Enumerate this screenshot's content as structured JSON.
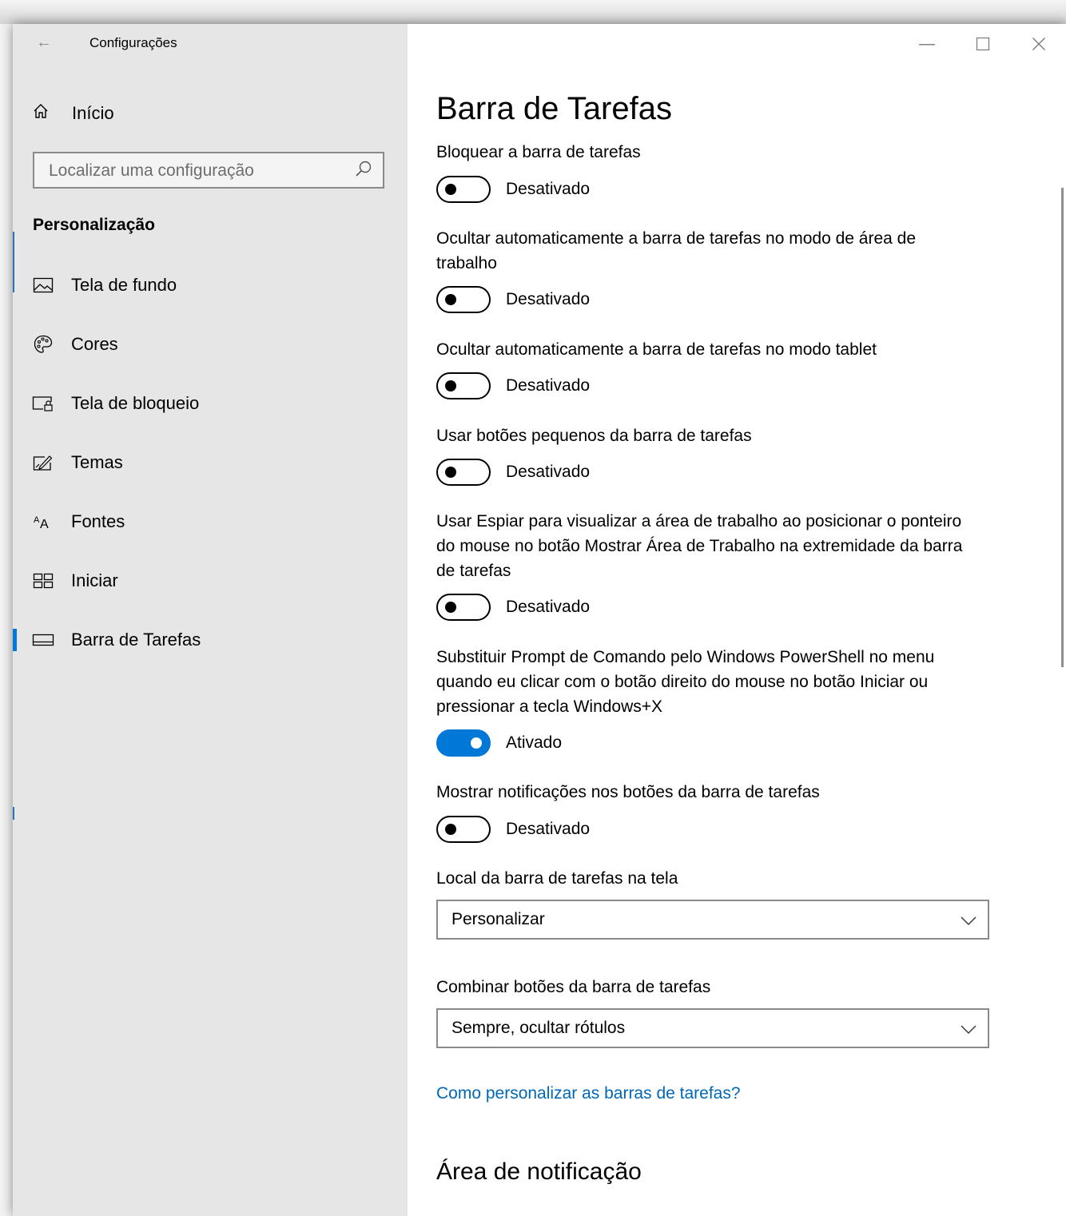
{
  "window": {
    "title": "Configurações",
    "controls": [
      "minimize-icon",
      "maximize-icon",
      "close-icon"
    ]
  },
  "sidebar": {
    "home": {
      "label": "Início",
      "icon": "home-icon"
    },
    "search": {
      "placeholder": "Localizar uma configuração",
      "icon": "search-icon"
    },
    "section": "Personalização",
    "items": [
      {
        "label": "Tela de fundo",
        "icon": "picture-icon",
        "active": false
      },
      {
        "label": "Cores",
        "icon": "palette-icon",
        "active": false
      },
      {
        "label": "Tela de bloqueio",
        "icon": "lock-screen-icon",
        "active": false
      },
      {
        "label": "Temas",
        "icon": "themes-icon",
        "active": false
      },
      {
        "label": "Fontes",
        "icon": "fonts-icon",
        "active": false
      },
      {
        "label": "Iniciar",
        "icon": "start-icon",
        "active": false
      },
      {
        "label": "Barra de Tarefas",
        "icon": "taskbar-icon",
        "active": true
      }
    ]
  },
  "main": {
    "title": "Barra de Tarefas",
    "settings": [
      {
        "label": "Bloquear a barra de tarefas",
        "state": "Desativado",
        "on": false
      },
      {
        "label": "Ocultar automaticamente a barra de tarefas no modo de área de trabalho",
        "state": "Desativado",
        "on": false
      },
      {
        "label": "Ocultar automaticamente a barra de tarefas no modo tablet",
        "state": "Desativado",
        "on": false
      },
      {
        "label": "Usar botões pequenos da barra de tarefas",
        "state": "Desativado",
        "on": false
      },
      {
        "label": "Usar Espiar para visualizar a área de trabalho ao posicionar o ponteiro do mouse no botão Mostrar Área de Trabalho na extremidade da barra de tarefas",
        "state": "Desativado",
        "on": false
      },
      {
        "label": "Substituir Prompt de Comando pelo Windows PowerShell no menu quando eu clicar com o botão direito do mouse no botão Iniciar ou pressionar a tecla Windows+X",
        "state": "Ativado",
        "on": true
      },
      {
        "label": "Mostrar notificações nos botões da barra de tarefas",
        "state": "Desativado",
        "on": false
      }
    ],
    "location": {
      "label": "Local da barra de tarefas na tela",
      "value": "Personalizar"
    },
    "combine": {
      "label": "Combinar botões da barra de tarefas",
      "value": "Sempre, ocultar rótulos"
    },
    "help_link": "Como personalizar as barras de tarefas?",
    "notification_heading": "Área de notificação"
  },
  "colors": {
    "accent": "#0078d7",
    "link": "#0067b8",
    "sidebar_bg": "#e6e6e6"
  }
}
